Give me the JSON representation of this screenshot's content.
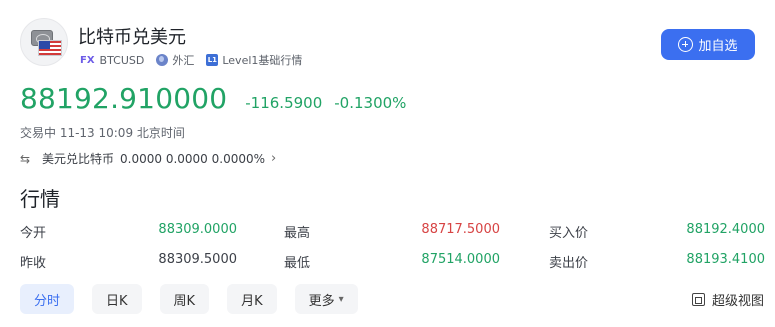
{
  "header": {
    "title": "比特币兑美元",
    "type_badge": "FX",
    "symbol": "BTCUSD",
    "market": "外汇",
    "level_badge": "L1",
    "level_label": "Level1基础行情",
    "add_watchlist_label": "加自选"
  },
  "quote": {
    "price": "88192.910000",
    "change": "-116.5900",
    "change_percent": "-0.1300%",
    "status": "交易中 11-13 10:09 北京时间"
  },
  "reverse_pair": {
    "label": "美元兑比特币",
    "values": "0.0000 0.0000 0.0000%",
    "chevron": "›"
  },
  "section_title": "行情",
  "stats": {
    "row1": {
      "open_label": "今开",
      "open_value": "88309.0000",
      "high_label": "最高",
      "high_value": "88717.5000",
      "bid_label": "买入价",
      "bid_value": "88192.4000"
    },
    "row2": {
      "prev_close_label": "昨收",
      "prev_close_value": "88309.5000",
      "low_label": "最低",
      "low_value": "87514.0000",
      "ask_label": "卖出价",
      "ask_value": "88193.4100"
    }
  },
  "tabs": [
    {
      "label": "分时",
      "active": true
    },
    {
      "label": "日K",
      "active": false
    },
    {
      "label": "周K",
      "active": false
    },
    {
      "label": "月K",
      "active": false
    },
    {
      "label": "更多",
      "active": false
    }
  ],
  "super_chart_label": "超级视图",
  "colors": {
    "up_green": "#21a365",
    "down_red": "#d74444",
    "accent_blue": "#3b6ff0"
  }
}
